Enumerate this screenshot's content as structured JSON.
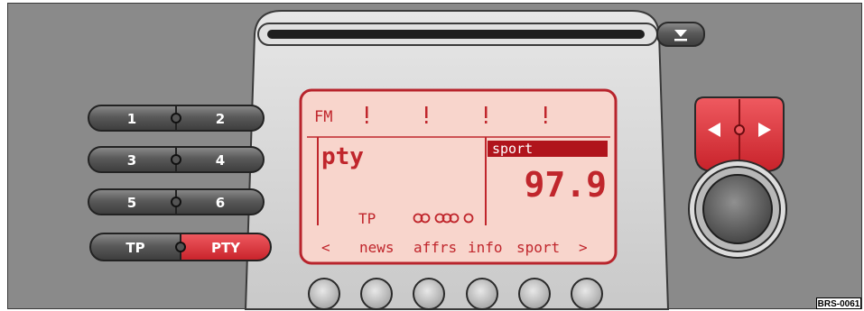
{
  "colors": {
    "panel": "#8a8a8a",
    "accent_red": "#dc2f36",
    "lcd_bg": "#f8d5cc",
    "lcd_text": "#c0262c",
    "highlight": "#b0141c"
  },
  "preset_buttons": [
    {
      "left": "1",
      "right": "2"
    },
    {
      "left": "3",
      "right": "4"
    },
    {
      "left": "5",
      "right": "6"
    },
    {
      "left": "TP",
      "right": "PTY"
    }
  ],
  "display": {
    "band": "FM",
    "mode_label": "pty",
    "category_highlight": "sport",
    "frequency": "97.9",
    "tp_indicator": "TP",
    "softkeys": [
      "<",
      "news",
      "affrs",
      "info",
      "sport",
      ">"
    ]
  },
  "cd_eject_icon": "eject-icon",
  "seek_icons": [
    "seek-left-icon",
    "seek-right-icon"
  ],
  "figure_code": "BRS-0061"
}
